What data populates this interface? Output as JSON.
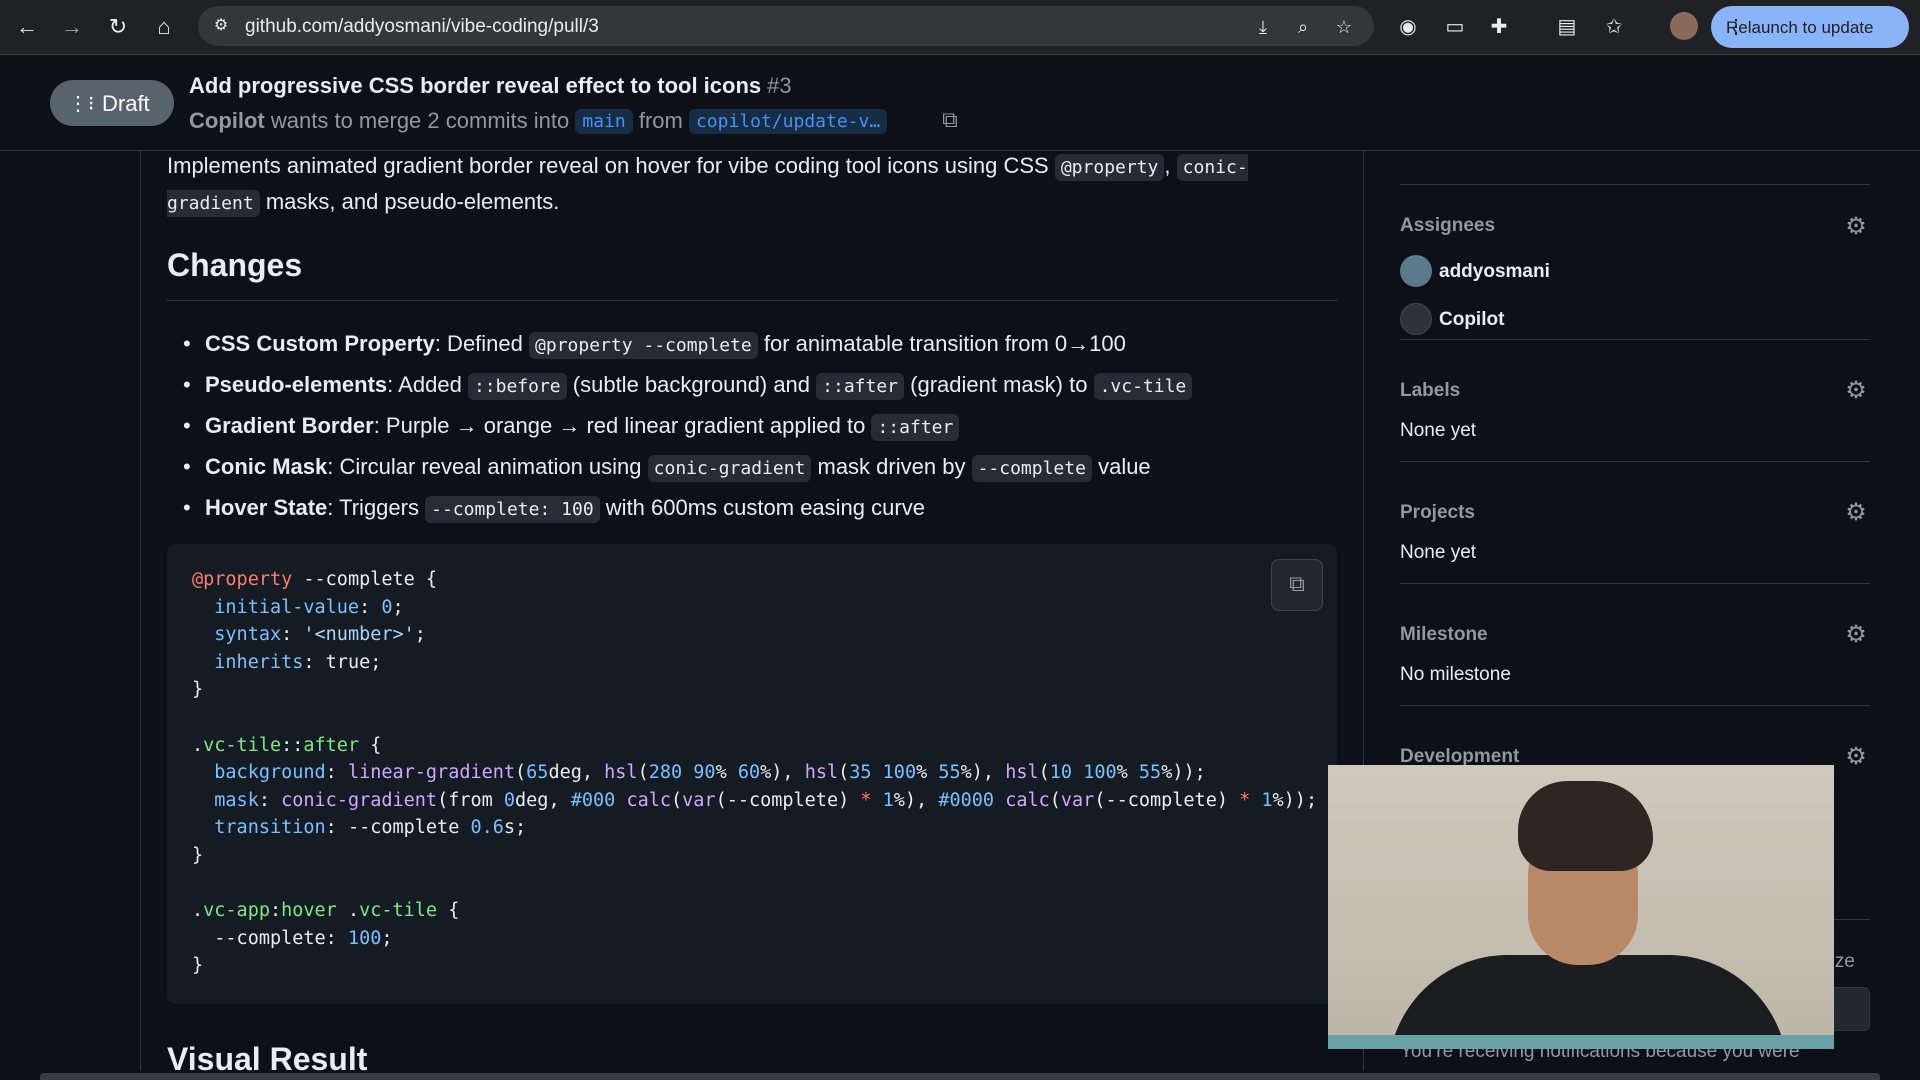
{
  "browser": {
    "url": "github.com/addyosmani/vibe-coding/pull/3",
    "relaunch_label": "Relaunch to update"
  },
  "pr_header": {
    "draft_label": "Draft",
    "title": "Add progressive CSS border reveal effect to tool icons",
    "number": "#3",
    "author": "Copilot",
    "merge_text": "wants to merge 2 commits into",
    "base_branch": "main",
    "from_text": "from",
    "head_branch": "copilot/update-v…"
  },
  "description": {
    "intro_prefix": "Implements animated gradient border reveal on hover for vibe coding tool icons using CSS",
    "intro_code1": "@property",
    "intro_sep": ",",
    "intro_code2": "conic-gradient",
    "intro_suffix": "masks, and pseudo-elements.",
    "changes_heading": "Changes",
    "changes": [
      {
        "term": "CSS Custom Property",
        "a": ": Defined",
        "code1": "@property --complete",
        "b": "for animatable transition from 0→100"
      },
      {
        "term": "Pseudo-elements",
        "a": ": Added",
        "code1": "::before",
        "b": "(subtle background) and",
        "code2": "::after",
        "c": "(gradient mask) to",
        "code3": ".vc-tile"
      },
      {
        "term": "Gradient Border",
        "a": ": Purple → orange → red linear gradient applied to",
        "code1": "::after"
      },
      {
        "term": "Conic Mask",
        "a": ": Circular reveal animation using",
        "code1": "conic-gradient",
        "b": "mask driven by",
        "code2": "--complete",
        "c": "value"
      },
      {
        "term": "Hover State",
        "a": ": Triggers",
        "code1": "--complete: 100",
        "b": "with 600ms custom easing curve"
      }
    ],
    "visual_heading": "Visual Result"
  },
  "sidebar": {
    "assignees_title": "Assignees",
    "assignees": [
      "addyosmani",
      "Copilot"
    ],
    "labels_title": "Labels",
    "labels_value": "None yet",
    "projects_title": "Projects",
    "projects_value": "None yet",
    "milestone_title": "Milestone",
    "milestone_value": "No milestone",
    "development_title": "Development",
    "customize_fragment": "nize",
    "notice": "You’re receiving notifications because you were"
  },
  "colors": {
    "accent": "#4493f8",
    "draft_badge": "#59636e",
    "relaunch": "#8ab4f8"
  },
  "icons": [
    "back-icon",
    "forward-icon",
    "reload-icon",
    "home-icon",
    "site-info-icon",
    "install-icon",
    "zoom-icon",
    "star-icon",
    "extension-icon",
    "gear-icon",
    "copy-icon",
    "draft-pr-icon"
  ]
}
